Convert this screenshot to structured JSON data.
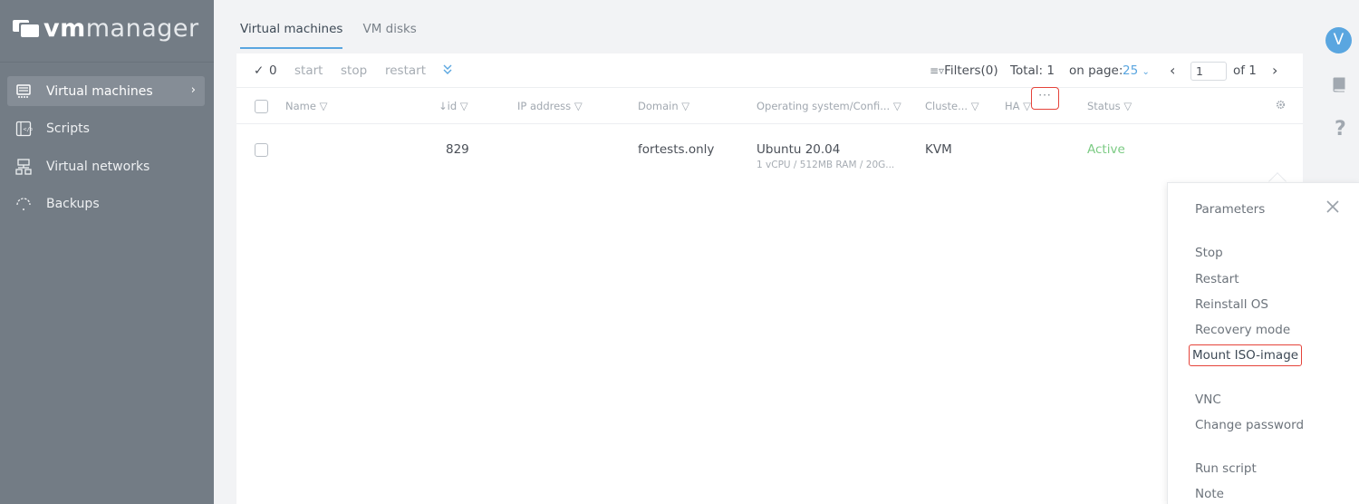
{
  "brand": {
    "logo_bold": "vm",
    "logo_light": "manager"
  },
  "sidebar": {
    "items": [
      {
        "label": "Virtual machines",
        "icon": "server-icon",
        "active": true
      },
      {
        "label": "Scripts",
        "icon": "script-icon",
        "active": false
      },
      {
        "label": "Virtual networks",
        "icon": "network-icon",
        "active": false
      },
      {
        "label": "Backups",
        "icon": "backup-icon",
        "active": false
      }
    ]
  },
  "tabs": [
    {
      "label": "Virtual machines",
      "active": true
    },
    {
      "label": "VM disks",
      "active": false
    }
  ],
  "toolbar": {
    "selected_count": "0",
    "start": "start",
    "stop": "stop",
    "restart": "restart",
    "filters": "Filters(0)",
    "total": "Total: 1",
    "on_page_label": "on page:",
    "on_page_value": "25",
    "page_value": "1",
    "of_pages": "of 1"
  },
  "table": {
    "columns": [
      "Name",
      "id",
      "IP address",
      "Domain",
      "Operating system/Confi...",
      "Cluste...",
      "HA",
      "Status"
    ],
    "rows": [
      {
        "name": "",
        "id": "829",
        "ip": "",
        "domain": "fortests.only",
        "os": "Ubuntu 20.04",
        "config": "1 vCPU / 512MB RAM / 20G...",
        "cluster": "KVM",
        "ha": "",
        "status": "Active"
      }
    ]
  },
  "menu": {
    "items": [
      "Parameters",
      "Stop",
      "Restart",
      "Reinstall OS",
      "Recovery mode",
      "Mount ISO-image",
      "VNC",
      "Change password",
      "Run script",
      "Note"
    ]
  },
  "user": {
    "initial": "V"
  },
  "colors": {
    "accent": "#5aa6e0",
    "active_status": "#7ccb84",
    "highlight": "#e5433a",
    "sidebar": "#737c85"
  }
}
